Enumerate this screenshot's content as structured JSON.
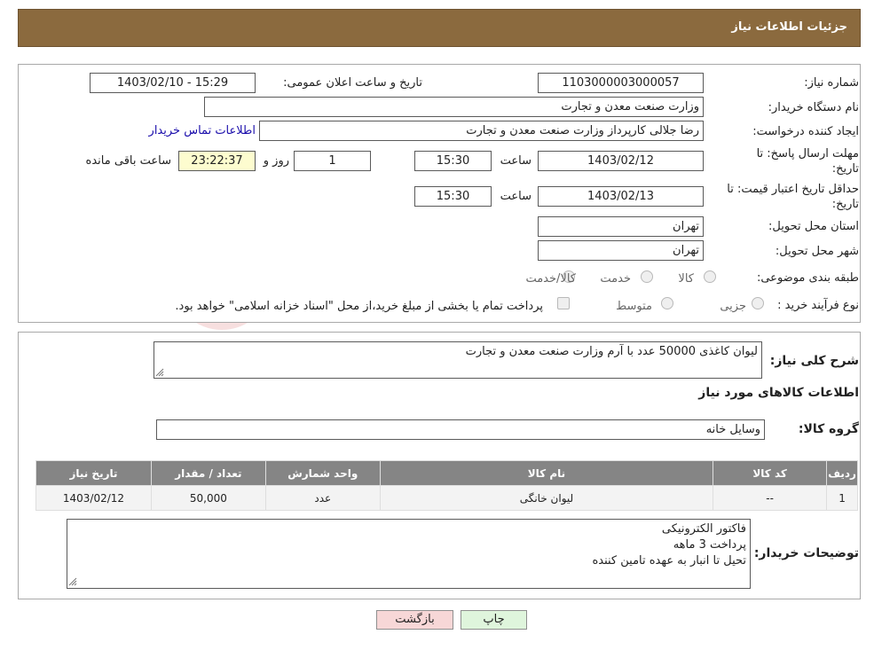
{
  "header": {
    "title": "جزئیات اطلاعات نیاز"
  },
  "form": {
    "need_number_label": "شماره نیاز:",
    "need_number": "1103000003000057",
    "announce_label": "تاریخ و ساعت اعلان عمومی:",
    "announce_value": "1403/02/10 - 15:29",
    "buyer_org_label": "نام دستگاه خریدار:",
    "buyer_org": "وزارت صنعت معدن و تجارت",
    "creator_label": "ایجاد کننده درخواست:",
    "creator": "رضا جلالی کارپرداز وزارت صنعت معدن و تجارت",
    "contact_link": "اطلاعات تماس خریدار",
    "deadline_label_1": "مهلت ارسال پاسخ: تا",
    "deadline_label_2": "تاریخ:",
    "deadline_date": "1403/02/12",
    "time_label": "ساعت",
    "deadline_time": "15:30",
    "days_value": "1",
    "days_label": "روز و",
    "remaining_time": "23:22:37",
    "remaining_label": "ساعت باقی مانده",
    "validity_label_1": "حداقل تاریخ اعتبار قیمت: تا",
    "validity_label_2": "تاریخ:",
    "validity_date": "1403/02/13",
    "validity_time": "15:30",
    "province_label": "استان محل تحویل:",
    "province": "تهران",
    "city_label": "شهر محل تحویل:",
    "city": "تهران",
    "category_label": "طبقه بندی موضوعی:",
    "category_options": [
      "کالا",
      "خدمت",
      "کالا/خدمت"
    ],
    "process_label": "نوع فرآیند خرید :",
    "process_options": [
      "جزیی",
      "متوسط"
    ],
    "process_note": "پرداخت تمام یا بخشی از مبلغ خرید،از محل \"اسناد خزانه اسلامی\" خواهد بود."
  },
  "details": {
    "description_label": "شرح کلی نیاز:",
    "description": "لیوان کاغذی 50000 عدد با آرم وزارت صنعت معدن و تجارت",
    "goods_info_title": "اطلاعات کالاهای مورد نیاز",
    "goods_group_label": "گروه کالا:",
    "goods_group": "وسایل خانه"
  },
  "table": {
    "headers": [
      "ردیف",
      "کد کالا",
      "نام کالا",
      "واحد شمارش",
      "تعداد / مقدار",
      "تاریخ نیاز"
    ],
    "rows": [
      [
        "1",
        "--",
        "لیوان خانگی",
        "عدد",
        "50,000",
        "1403/02/12"
      ]
    ]
  },
  "buyer_notes": {
    "label": "توضیحات خریدار:",
    "lines": [
      "فاکتور الکترونیکی",
      "پرداخت 3 ماهه",
      "تحیل تا انبار به عهده تامین کننده"
    ]
  },
  "buttons": {
    "print": "چاپ",
    "back": "بازگشت"
  },
  "watermark": {
    "text": "AriaTender.neT"
  },
  "colors": {
    "header_bg": "#8b6a3e",
    "table_header_bg": "#858585",
    "remaining_bg": "#fdfccf",
    "back_button_bg": "#f7d7d7",
    "print_button_bg": "#dff5dc"
  }
}
